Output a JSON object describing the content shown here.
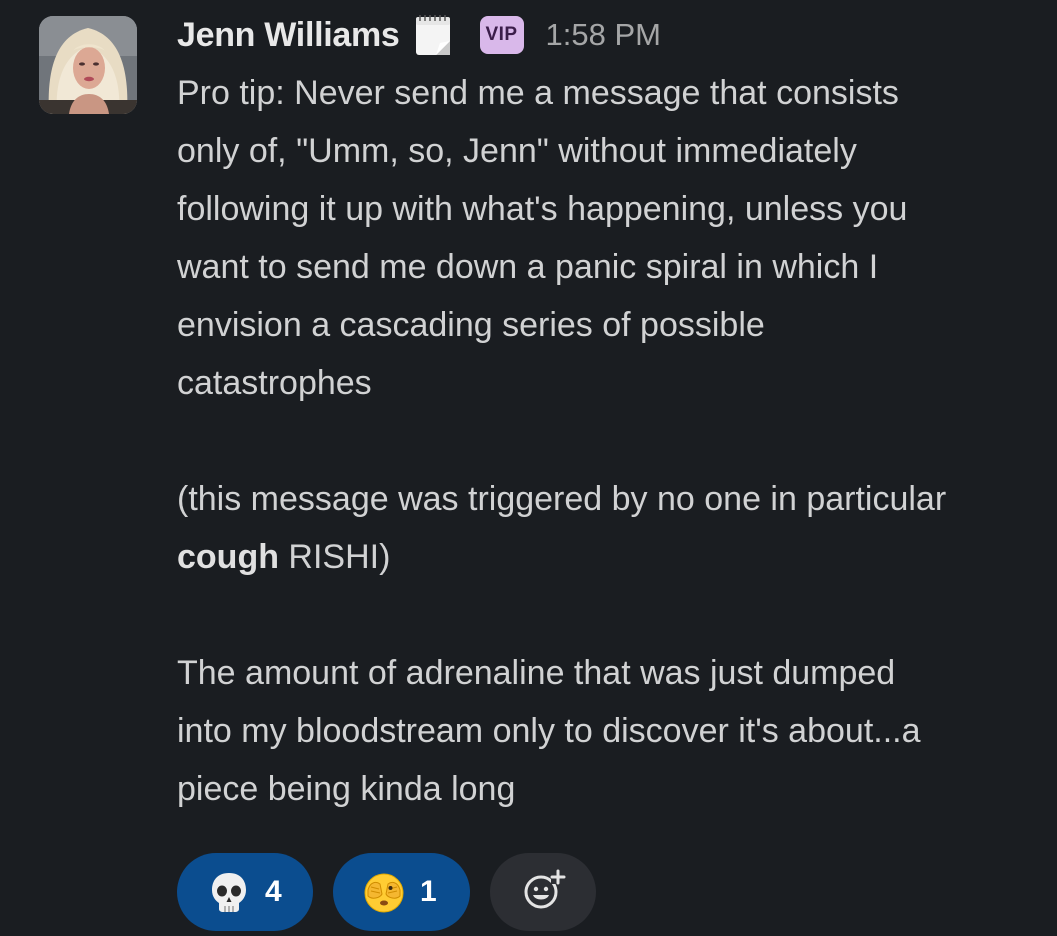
{
  "message": {
    "sender": "Jenn Williams",
    "badge": "VIP",
    "timestamp": "1:58 PM",
    "status_icon": "calendar-icon",
    "lines": [
      "Pro tip: Never send me a message that consists",
      "only of, \"Umm, so, Jenn\" without immediately",
      "following it up with what's happening, unless you",
      "want to send me down a panic spiral in which I",
      "envision a cascading series of possible",
      "catastrophes",
      "(this message was triggered by no one in particular",
      "The amount of adrenaline that was just dumped",
      "into my bloodstream only to discover it's about...a",
      "piece being kinda long"
    ],
    "bold_word": "cough",
    "after_bold": " RISHI)"
  },
  "reactions": [
    {
      "icon": "skull-icon",
      "count": "4"
    },
    {
      "icon": "face-with-peeking-eye-icon",
      "count": "1"
    }
  ],
  "add_reaction_icon": "add-reaction-icon",
  "colors": {
    "background": "#1a1d21",
    "reaction_active": "#0b4d8f",
    "vip_badge": "#d9b8ea",
    "add_reaction_bg": "#2c2e33"
  }
}
